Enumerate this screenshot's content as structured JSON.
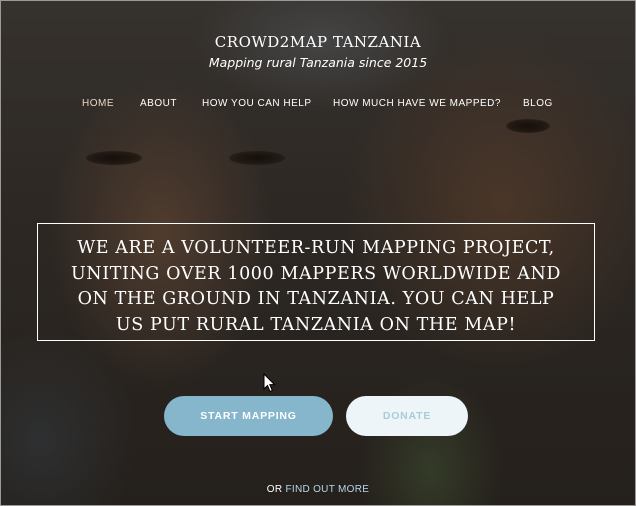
{
  "site": {
    "title": "CROWD2MAP TANZANIA",
    "tagline": "Mapping rural Tanzania since 2015"
  },
  "nav": {
    "items": [
      {
        "label": "HOME",
        "active": true
      },
      {
        "label": "ABOUT",
        "active": false
      },
      {
        "label": "HOW YOU CAN HELP",
        "active": false
      },
      {
        "label": "HOW MUCH HAVE WE MAPPED?",
        "active": false
      },
      {
        "label": "BLOG",
        "active": false
      }
    ]
  },
  "hero": {
    "lines": [
      "WE ARE A VOLUNTEER-RUN MAPPING PROJECT,",
      "UNITING OVER 1000 MAPPERS WORLDWIDE AND",
      "ON THE GROUND IN TANZANIA. YOU CAN HELP",
      "US PUT RURAL TANZANIA ON THE MAP!"
    ]
  },
  "buttons": {
    "start_label": "START MAPPING",
    "donate_label": "DONATE"
  },
  "find_more": {
    "prefix": "OR",
    "link_label": "FIND OUT MORE"
  },
  "colors": {
    "primary_button": "#86b6cc",
    "secondary_button": "#eef5f8",
    "link": "#b5d6e8"
  },
  "icons": {
    "cursor": "mouse-pointer-icon"
  }
}
